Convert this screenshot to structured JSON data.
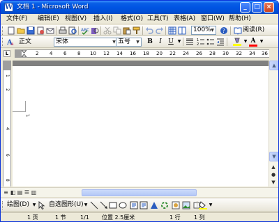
{
  "window": {
    "title": "文档 1 - Microsoft Word",
    "app_icon": "W",
    "minimize_glyph": "_",
    "maximize_glyph": "□",
    "close_glyph": "×"
  },
  "menubar": {
    "items": [
      "文件(F)",
      "编辑(E)",
      "视图(V)",
      "插入(I)",
      "格式(O)",
      "工具(T)",
      "表格(A)",
      "窗口(W)",
      "帮助(H)"
    ],
    "help_box": "×"
  },
  "standard_toolbar": {
    "icons": [
      "new-icon",
      "open-icon",
      "save-icon",
      "permission-icon",
      "email-icon",
      "print-icon",
      "print-preview-icon",
      "spelling-icon",
      "research-icon",
      "cut-icon",
      "copy-icon",
      "paste-icon",
      "format-painter-icon",
      "undo-icon",
      "redo-icon",
      "insert-table-icon",
      "columns-icon",
      "drawing-icon",
      "zoom-icon",
      "help-icon",
      "read-icon"
    ],
    "zoom_value": "100%",
    "read_label": "阅读(R)"
  },
  "formatting_toolbar": {
    "style_icon": "styles-icon",
    "style_value": "正文",
    "font_value": "宋体",
    "size_value": "五号",
    "bold": "B",
    "italic": "I",
    "underline": "U",
    "font_color": "A"
  },
  "ruler": {
    "corner_glyph": "L",
    "numbers": [
      "2",
      "4",
      "6",
      "8",
      "10",
      "12",
      "14",
      "16",
      "18",
      "20",
      "22",
      "24",
      "26",
      "28",
      "30",
      "32",
      "34",
      "36"
    ],
    "vertical_numbers": [
      "1",
      "2",
      "4",
      "6",
      "8"
    ]
  },
  "document": {
    "paragraph_mark": "↵"
  },
  "vscroll": {
    "up": "▲",
    "down": "▼",
    "prev_page": "▲",
    "browse": "●",
    "next_page": "▼"
  },
  "drawing_toolbar": {
    "draw_label": "绘图(D)",
    "autoshapes_label": "自选图形(U)"
  },
  "statusbar": {
    "page": "1 页",
    "section": "1 节",
    "page_of": "1/1",
    "position": "位置 2.5厘米",
    "line": "1 行",
    "column": "1 列"
  },
  "colors": {
    "titlebar": "#0054E3",
    "chrome": "#ECE9D8",
    "highlight": "#FFFF00",
    "font_color": "#FF0000"
  }
}
